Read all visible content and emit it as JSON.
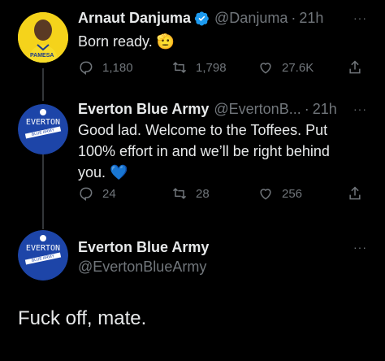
{
  "tweets": [
    {
      "name": "Arnaut Danjuma",
      "handle": "@Danjuma",
      "sep": "·",
      "time": "21h",
      "text": "Born ready.",
      "emoji": "🫡",
      "replies": "1,180",
      "retweets": "1,798",
      "likes": "27.6K",
      "avatar_text": "PAMESA"
    },
    {
      "name": "Everton Blue Army",
      "handle": "@EvertonB...",
      "sep": "·",
      "time": "21h",
      "text_lines": [
        "Good lad. Welcome to the Toffees. Put",
        "100% effort in and we’ll be right behind",
        "you. 💙"
      ],
      "replies": "24",
      "retweets": "28",
      "likes": "256",
      "avatar_top": "EVERTON",
      "avatar_ribbon": "BLUE ARMY"
    }
  ],
  "main": {
    "name": "Everton Blue Army",
    "handle": "@EvertonBlueArmy",
    "text": "Fuck off, mate.",
    "avatar_top": "EVERTON",
    "avatar_ribbon": "BLUE ARMY"
  },
  "more_icon": "···",
  "colors": {
    "accent": "#1d9bf0",
    "muted": "#71767b",
    "everton_blue": "#1d45a8"
  }
}
